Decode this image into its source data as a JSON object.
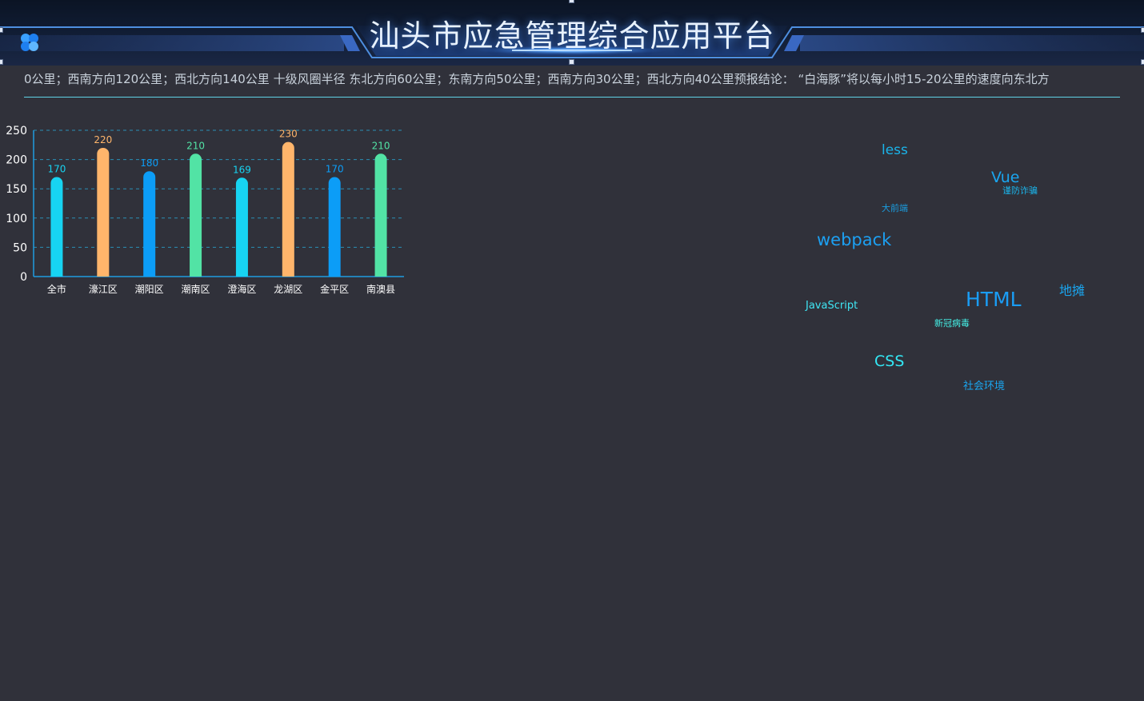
{
  "header": {
    "title": "汕头市应急管理综合应用平台",
    "logo_icon": "flower-logo-icon"
  },
  "ticker": {
    "text": "0公里；西南方向120公里；西北方向140公里 十级风圈半径   东北方向60公里；东南方向50公里；西南方向30公里；西北方向40公里预报结论：  “白海豚”将以每小时15-20公里的速度向东北方"
  },
  "chart_data": {
    "type": "bar",
    "categories": [
      "全市",
      "濠江区",
      "潮阳区",
      "潮南区",
      "澄海区",
      "龙湖区",
      "金平区",
      "南澳县"
    ],
    "values": [
      170,
      220,
      180,
      210,
      169,
      230,
      170,
      210
    ],
    "data_labels": [
      "170",
      "220",
      "180",
      "210",
      "169",
      "230",
      "170",
      "210"
    ],
    "bar_colors": [
      "#17d4f2",
      "#ffb56b",
      "#0c9df7",
      "#52e3a5",
      "#17d4f2",
      "#ffb56b",
      "#0c9df7",
      "#52e3a5"
    ],
    "ylim": [
      0,
      250
    ],
    "yticks": [
      "0",
      "50",
      "100",
      "150",
      "200",
      "250"
    ],
    "grid": true,
    "title": "",
    "xlabel": "",
    "ylabel": ""
  },
  "word_cloud": {
    "words": [
      {
        "text": "less",
        "color": "#1ab4ea"
      },
      {
        "text": "Vue",
        "color": "#1aa6f0"
      },
      {
        "text": "谨防诈骗",
        "color": "#1ab4ea"
      },
      {
        "text": "大前端",
        "color": "#1a9de0"
      },
      {
        "text": "webpack",
        "color": "#1ca0f2"
      },
      {
        "text": "地摊",
        "color": "#1aa6f0"
      },
      {
        "text": "HTML",
        "color": "#1a9df5"
      },
      {
        "text": "JavaScript",
        "color": "#3fe7f5"
      },
      {
        "text": "新冠病毒",
        "color": "#45f0e6"
      },
      {
        "text": "CSS",
        "color": "#33e8f5"
      },
      {
        "text": "社会环境",
        "color": "#1aa6f0"
      }
    ]
  },
  "colors": {
    "background": "#30313a",
    "header_bg": "#101c33",
    "accent_line": "#5fd3e6"
  }
}
